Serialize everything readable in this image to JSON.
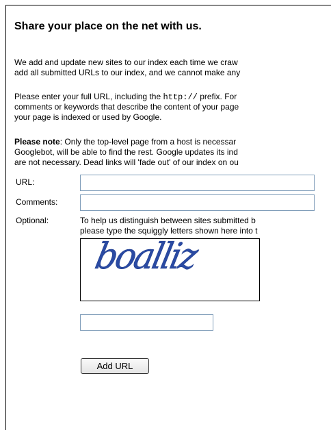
{
  "title": "Share your place on the net with us.",
  "intro": {
    "lines": [
      "We add and update new sites to our index each time we craw",
      "add all submitted URLs to our index, and we cannot make any"
    ]
  },
  "instructions": {
    "line1_before": "Please enter your full URL, including the ",
    "line1_code": "http://",
    "line1_after": " prefix. For",
    "line2": "comments or keywords that describe the content of your page",
    "line3": "your page is indexed or used by Google."
  },
  "note": {
    "bold": "Please note",
    "line1_rest": ": Only the top-level page from a host is necessar",
    "line2": "Googlebot, will be able to find the rest. Google updates its ind",
    "line3": "are not necessary. Dead links will 'fade out' of our index on ou"
  },
  "form": {
    "url_label": "URL:",
    "url_value": "",
    "comments_label": "Comments:",
    "comments_value": "",
    "optional_label": "Optional:",
    "optional_line1": "To help us distinguish between sites submitted b",
    "optional_line2": "please type the squiggly letters shown here into t",
    "captcha_text": "boalliz",
    "captcha_value": "",
    "submit_label": "Add URL"
  }
}
